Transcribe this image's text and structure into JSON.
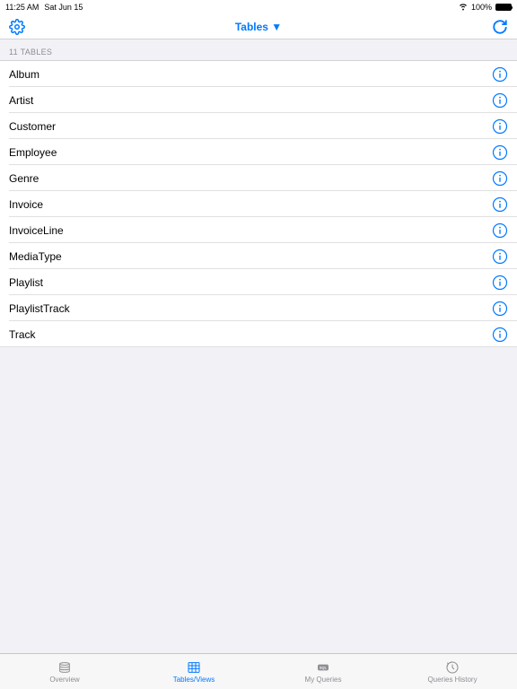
{
  "status": {
    "time": "11:25 AM",
    "date": "Sat Jun 15",
    "battery": "100%"
  },
  "nav": {
    "title": "Tables ▼"
  },
  "section": {
    "header": "11 TABLES"
  },
  "tables": [
    {
      "name": "Album"
    },
    {
      "name": "Artist"
    },
    {
      "name": "Customer"
    },
    {
      "name": "Employee"
    },
    {
      "name": "Genre"
    },
    {
      "name": "Invoice"
    },
    {
      "name": "InvoiceLine"
    },
    {
      "name": "MediaType"
    },
    {
      "name": "Playlist"
    },
    {
      "name": "PlaylistTrack"
    },
    {
      "name": "Track"
    }
  ],
  "tabs": [
    {
      "label": "Overview",
      "active": false
    },
    {
      "label": "Tables/Views",
      "active": true
    },
    {
      "label": "My Queries",
      "active": false
    },
    {
      "label": "Queries History",
      "active": false
    }
  ]
}
